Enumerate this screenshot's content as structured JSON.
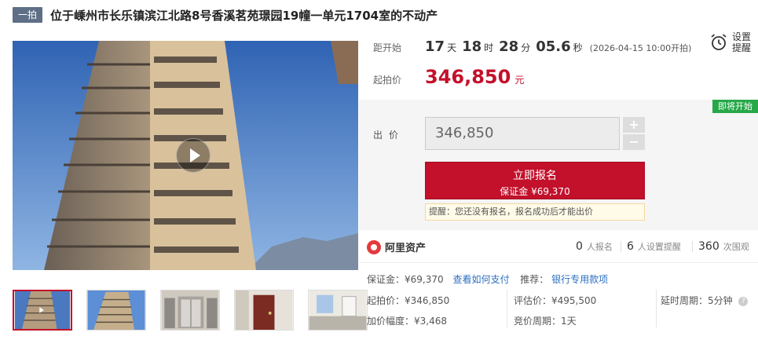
{
  "header": {
    "badge": "一拍",
    "title": "位于嵊州市长乐镇滨江北路8号香溪茗苑璟园19幢一单元1704室的不动产"
  },
  "auction": {
    "countdown_label": "距开始",
    "days": "17",
    "days_unit": "天",
    "hours": "18",
    "hours_unit": "时",
    "minutes": "28",
    "minutes_unit": "分",
    "seconds": "05.6",
    "seconds_unit": "秒",
    "start_note": "(2026-04-15 10:00开拍)",
    "start_price_label": "起拍价",
    "start_price": "346,850",
    "start_price_unit": "元",
    "reminder_label": "设置提醒",
    "status_tag": "即将开始",
    "bid_label": "出价",
    "bid_value": "346,850",
    "plus": "+",
    "minus": "−",
    "signup_label": "立即报名",
    "deposit_line": "保证金 ¥69,370",
    "tip": "提醒：您还没有报名，报名成功后才能出价"
  },
  "stats": {
    "brand": "阿里资产",
    "signups": "0",
    "signups_label": "人报名",
    "reminders": "6",
    "reminders_label": "人设置提醒",
    "views": "360",
    "views_label": "次围观"
  },
  "details": {
    "deposit": "保证金：¥69,370",
    "deposit_link": "查看如何支付",
    "recommend": "推荐：",
    "recommend_link": "银行专用款项",
    "start_price": "起拍价：¥346,850",
    "increment": "加价幅度：¥3,468",
    "appraisal": "评估价：¥495,500",
    "period": "竞价周期：1天",
    "delay": "延时周期：5分钟",
    "help": "?"
  },
  "media": {
    "play_icon": "play-icon",
    "thumbnails": [
      "building-exterior",
      "building-exterior-2",
      "elevator-lobby",
      "apartment-door",
      "interior-room"
    ]
  },
  "colors": {
    "accent": "#c3102b",
    "status_green": "#26a849",
    "link": "#2b6fc2"
  }
}
